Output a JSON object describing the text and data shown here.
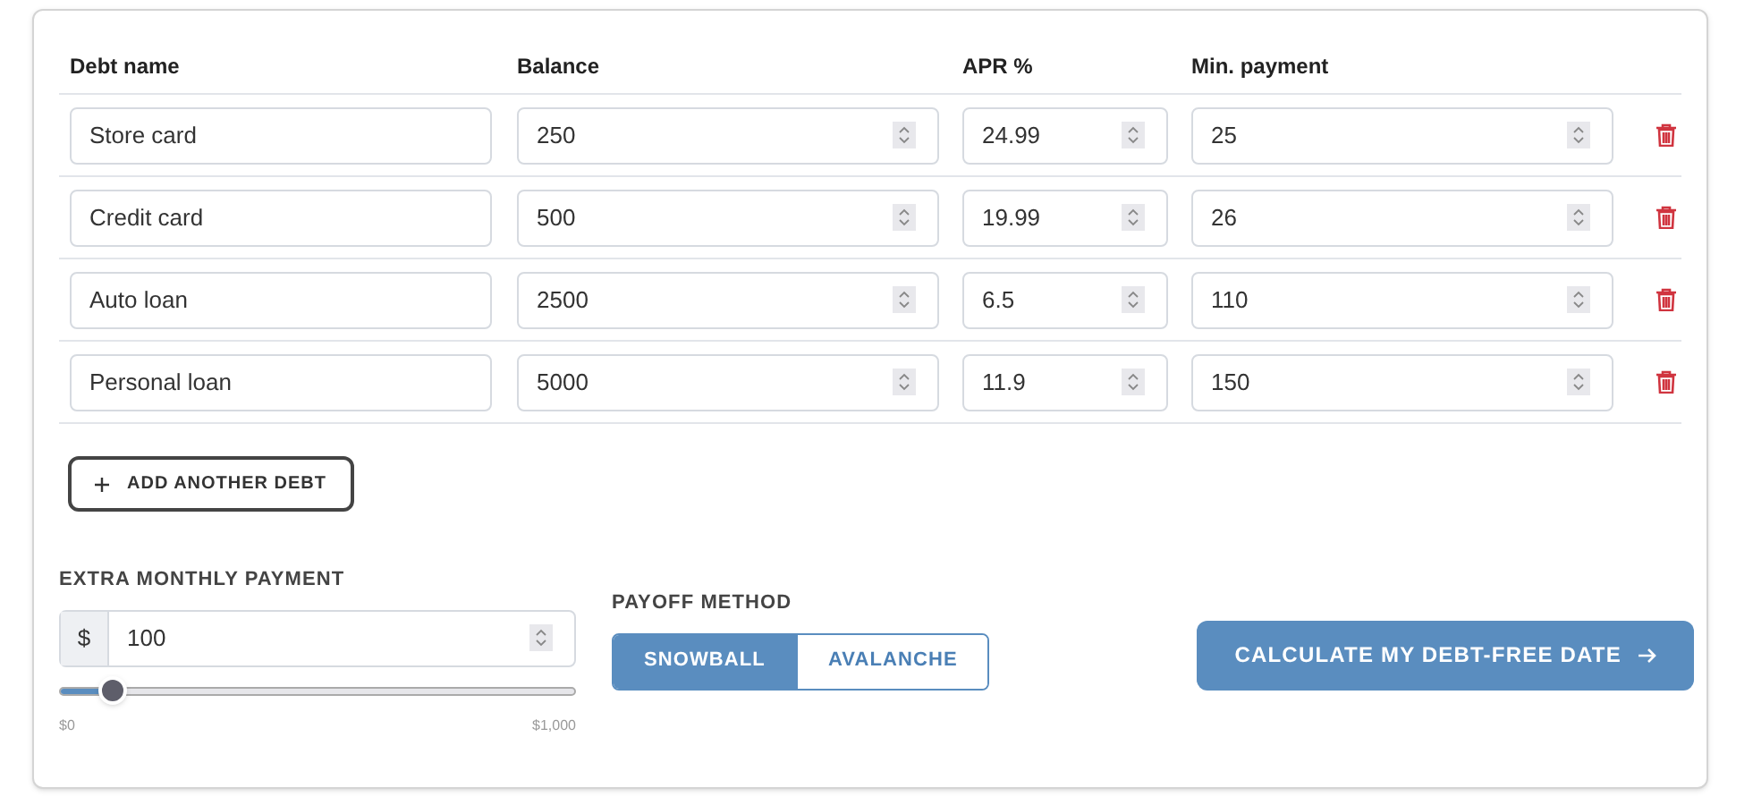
{
  "table": {
    "columns": [
      "Debt name",
      "Balance",
      "APR %",
      "Min. payment"
    ],
    "rows": [
      {
        "name": "Store card",
        "balance": "250",
        "apr": "24.99",
        "min_payment": "25"
      },
      {
        "name": "Credit card",
        "balance": "500",
        "apr": "19.99",
        "min_payment": "26"
      },
      {
        "name": "Auto loan",
        "balance": "2500",
        "apr": "6.5",
        "min_payment": "110"
      },
      {
        "name": "Personal loan",
        "balance": "5000",
        "apr": "11.9",
        "min_payment": "150"
      }
    ]
  },
  "add_button": {
    "label": "ADD ANOTHER DEBT"
  },
  "extra_payment": {
    "label": "EXTRA MONTHLY PAYMENT",
    "prefix": "$",
    "value": "100",
    "level": 0.1,
    "min_label": "$0",
    "max_label": "$1,000"
  },
  "payoff_method": {
    "label": "PAYOFF METHOD",
    "options": [
      {
        "label": "SNOWBALL",
        "selected": true
      },
      {
        "label": "AVALANCHE",
        "selected": false
      }
    ]
  },
  "calculate_button": {
    "label": "CALCULATE MY DEBT-FREE DATE"
  }
}
